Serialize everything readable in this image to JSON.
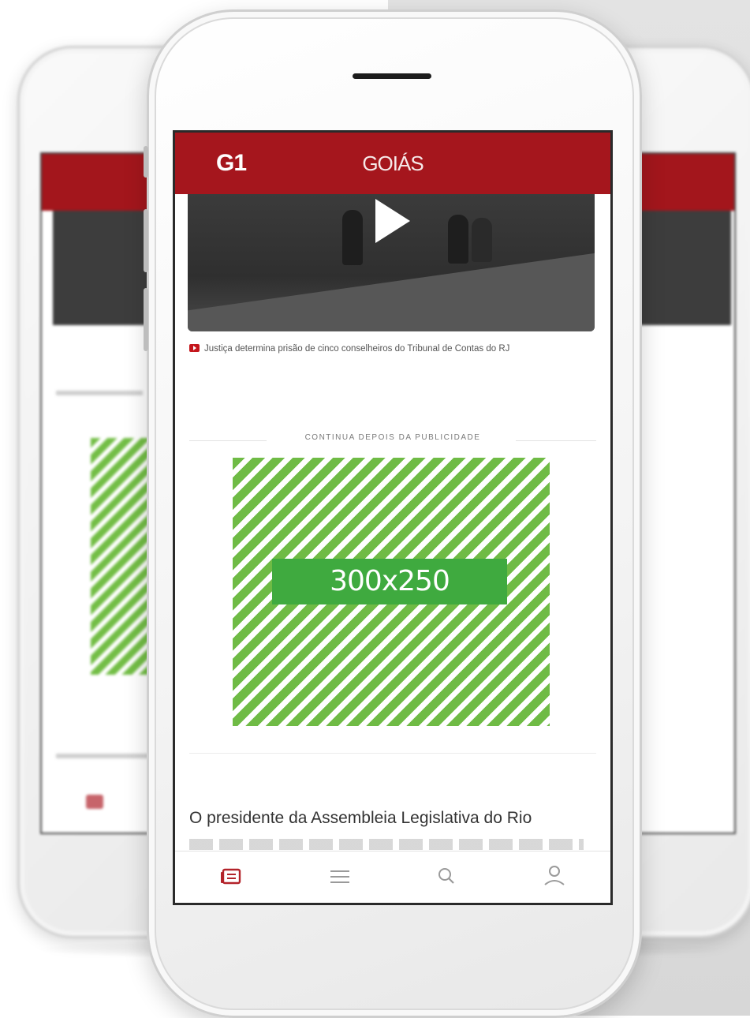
{
  "app": {
    "logo": "G1",
    "region_title": "GOIÁS"
  },
  "video": {
    "caption": "Justiça determina prisão de cinco conselheiros do Tribunal de Contas do RJ"
  },
  "ad": {
    "label": "CONTINUA DEPOIS DA PUBLICIDADE",
    "size_label": "300x250"
  },
  "article": {
    "first_line": "O presidente da Assembleia Legislativa do Rio"
  },
  "bottom_nav": {
    "items": [
      {
        "icon": "feed-icon",
        "active": true
      },
      {
        "icon": "menu-icon",
        "active": false
      },
      {
        "icon": "search-icon",
        "active": false
      },
      {
        "icon": "user-icon",
        "active": false
      }
    ]
  },
  "colors": {
    "brand_red": "#a5161d",
    "ad_green": "#3faa3f",
    "stripe_green": "#6fbb45"
  }
}
